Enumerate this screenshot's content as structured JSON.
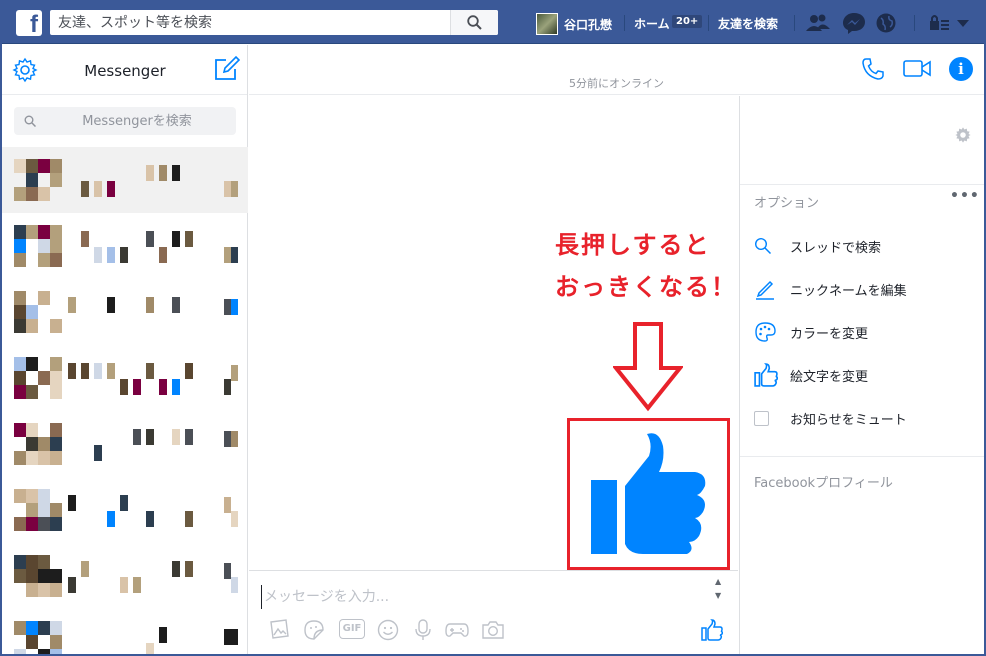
{
  "topbar": {
    "logo": "f",
    "search_placeholder": "友達、スポット等を検索",
    "profile_name": "谷口孔懋",
    "home_label": "ホーム",
    "home_badge": "20+",
    "find_friends_label": "友達を検索"
  },
  "left": {
    "title": "Messenger",
    "search_placeholder": "Messengerを検索"
  },
  "conversation": {
    "online_status": "5分前にオンライン",
    "annotation_line1": "長押しすると",
    "annotation_line2": "おっきくなる！",
    "input_placeholder": "メッセージを入力...",
    "composer_icons": [
      "image-icon",
      "sticker-icon",
      "gif-icon",
      "emoji-icon",
      "microphone-icon",
      "game-controller-icon",
      "camera-icon"
    ],
    "gif_label": "GIF"
  },
  "right": {
    "options_title": "オプション",
    "options_more": "•••",
    "options": [
      {
        "label": "スレッドで検索",
        "icon": "search-icon"
      },
      {
        "label": "ニックネームを編集",
        "icon": "pencil-icon"
      },
      {
        "label": "カラーを変更",
        "icon": "palette-icon"
      },
      {
        "label": "絵文字を変更",
        "icon": "thumbs-up-icon"
      },
      {
        "label": "お知らせをミュート",
        "icon": "checkbox-icon"
      }
    ],
    "facebook_profile_title": "Facebookプロフィール"
  },
  "colors": {
    "brand": "#3b5998",
    "accent": "#0084ff",
    "annotation": "#e8222b"
  }
}
